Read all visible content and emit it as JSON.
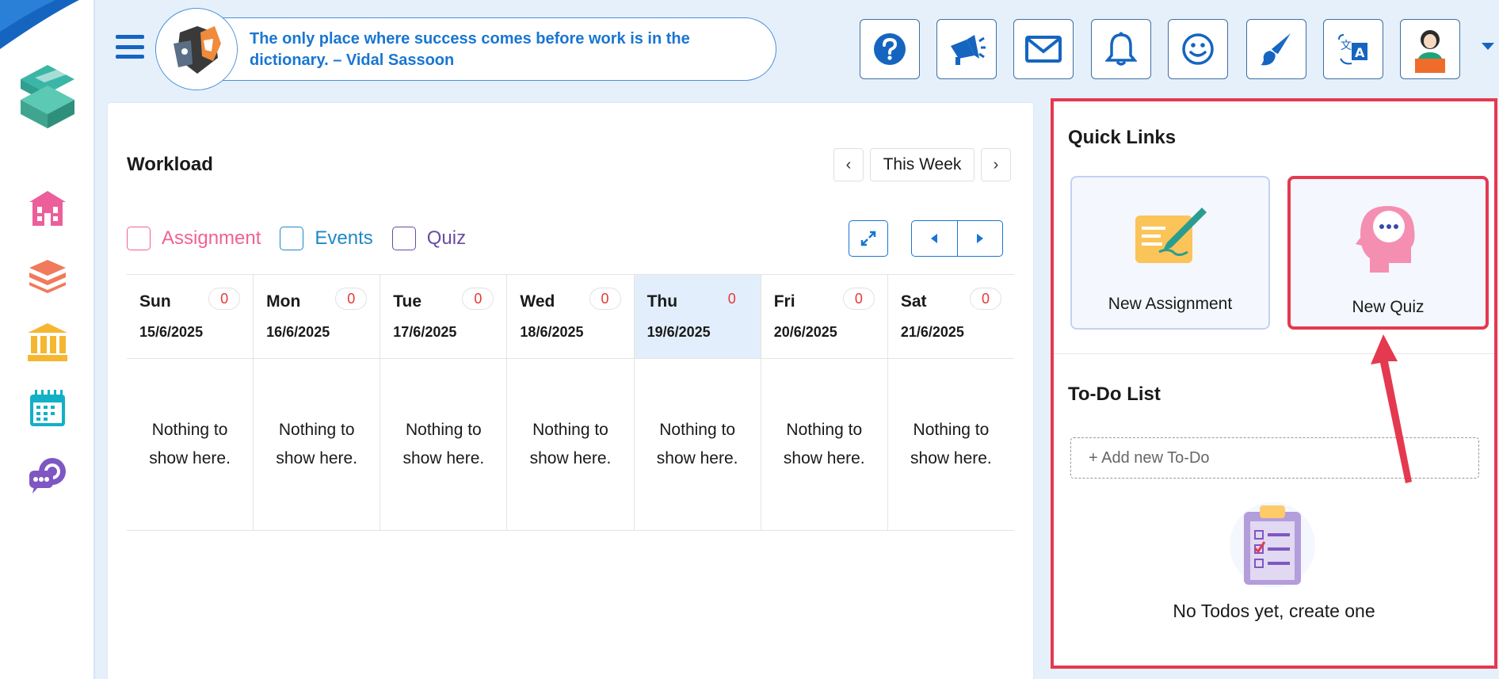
{
  "header": {
    "quote": "The only place where success comes before work is in the dictionary. – Vidal Sassoon",
    "icons": [
      "help-icon",
      "megaphone-icon",
      "mail-icon",
      "bell-icon",
      "smiley-icon",
      "paintbrush-icon",
      "translate-icon",
      "profile-avatar"
    ]
  },
  "sidebar": {
    "icons": [
      "school-icon",
      "books-icon",
      "institution-icon",
      "calendar-icon",
      "chat-icon"
    ]
  },
  "workload": {
    "title": "Workload",
    "range_label": "This Week",
    "filters": [
      {
        "label": "Assignment",
        "color": "#f06292"
      },
      {
        "label": "Events",
        "color": "#1e88c8"
      },
      {
        "label": "Quiz",
        "color": "#6a4ca5"
      }
    ],
    "days": [
      {
        "name": "Sun",
        "date": "15/6/2025",
        "count": "0",
        "empty": "Nothing to show here."
      },
      {
        "name": "Mon",
        "date": "16/6/2025",
        "count": "0",
        "empty": "Nothing to show here."
      },
      {
        "name": "Tue",
        "date": "17/6/2025",
        "count": "0",
        "empty": "Nothing to show here."
      },
      {
        "name": "Wed",
        "date": "18/6/2025",
        "count": "0",
        "empty": "Nothing to show here."
      },
      {
        "name": "Thu",
        "date": "19/6/2025",
        "count": "0",
        "empty": "Nothing to show here."
      },
      {
        "name": "Fri",
        "date": "20/6/2025",
        "count": "0",
        "empty": "Nothing to show here."
      },
      {
        "name": "Sat",
        "date": "21/6/2025",
        "count": "0",
        "empty": "Nothing to show here."
      }
    ],
    "highlighted_day": "Thu"
  },
  "quick_links": {
    "title": "Quick Links",
    "items": [
      {
        "label": "New Assignment"
      },
      {
        "label": "New Quiz"
      }
    ]
  },
  "todo": {
    "title": "To-Do List",
    "placeholder": "+ Add new To-Do",
    "empty_text": "No Todos yet, create one"
  },
  "colors": {
    "brand_blue": "#1976d2",
    "highlight_red": "#e53950",
    "count_red": "#e53935"
  }
}
